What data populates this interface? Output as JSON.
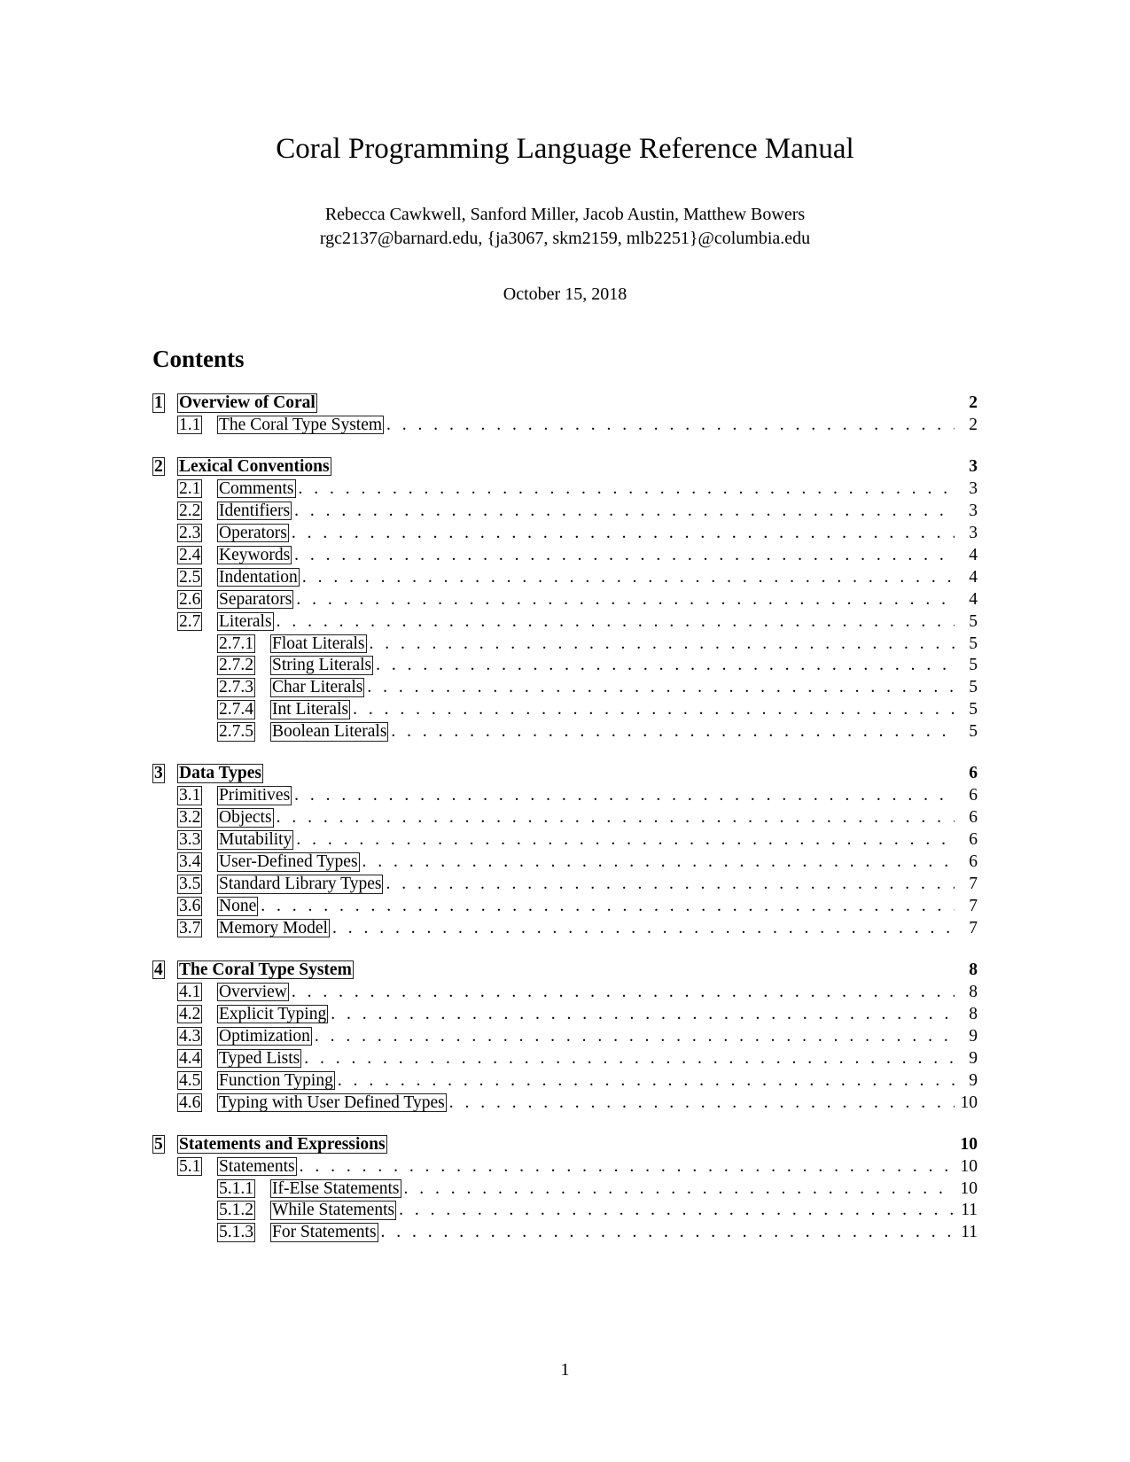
{
  "title": "Coral Programming Language Reference Manual",
  "authors_line1": "Rebecca Cawkwell, Sanford Miller, Jacob Austin, Matthew Bowers",
  "authors_line2": "rgc2137@barnard.edu, {ja3067, skm2159, mlb2251}@columbia.edu",
  "date": "October 15, 2018",
  "contents_heading": "Contents",
  "dots": ". . . . . . . . . . . . . . . . . . . . . . . . . . . . . . . . . . . . . . . . . . . . . . . . . . . . . . . . . . . . . . . . . . . . . . . . . . . . . . . . . . . . . . . . . . . . . . . . . . . . . . . . . . . . . . . . . . . . . . . . . . . . . . . . . . . . . . . . . . . . . . . .",
  "toc": [
    {
      "num": "1",
      "label": "Overview of Coral",
      "page": "2",
      "children": [
        {
          "num": "1.1",
          "label": "The Coral Type System",
          "page": "2"
        }
      ]
    },
    {
      "num": "2",
      "label": "Lexical Conventions",
      "page": "3",
      "children": [
        {
          "num": "2.1",
          "label": "Comments",
          "page": "3"
        },
        {
          "num": "2.2",
          "label": "Identifiers",
          "page": "3"
        },
        {
          "num": "2.3",
          "label": "Operators",
          "page": "3"
        },
        {
          "num": "2.4",
          "label": "Keywords",
          "page": "4"
        },
        {
          "num": "2.5",
          "label": "Indentation",
          "page": "4"
        },
        {
          "num": "2.6",
          "label": "Separators",
          "page": "4"
        },
        {
          "num": "2.7",
          "label": "Literals",
          "page": "5",
          "children": [
            {
              "num": "2.7.1",
              "label": "Float Literals",
              "page": "5"
            },
            {
              "num": "2.7.2",
              "label": "String Literals",
              "page": "5"
            },
            {
              "num": "2.7.3",
              "label": "Char Literals",
              "page": "5"
            },
            {
              "num": "2.7.4",
              "label": "Int Literals",
              "page": "5"
            },
            {
              "num": "2.7.5",
              "label": "Boolean Literals",
              "page": "5"
            }
          ]
        }
      ]
    },
    {
      "num": "3",
      "label": "Data Types",
      "page": "6",
      "children": [
        {
          "num": "3.1",
          "label": "Primitives",
          "page": "6"
        },
        {
          "num": "3.2",
          "label": "Objects",
          "page": "6"
        },
        {
          "num": "3.3",
          "label": "Mutability",
          "page": "6"
        },
        {
          "num": "3.4",
          "label": "User-Defined Types",
          "page": "6"
        },
        {
          "num": "3.5",
          "label": "Standard Library Types",
          "page": "7"
        },
        {
          "num": "3.6",
          "label": "None",
          "page": "7"
        },
        {
          "num": "3.7",
          "label": "Memory Model",
          "page": "7"
        }
      ]
    },
    {
      "num": "4",
      "label": "The Coral Type System",
      "page": "8",
      "children": [
        {
          "num": "4.1",
          "label": "Overview",
          "page": "8"
        },
        {
          "num": "4.2",
          "label": "Explicit Typing",
          "page": "8"
        },
        {
          "num": "4.3",
          "label": "Optimization",
          "page": "9"
        },
        {
          "num": "4.4",
          "label": "Typed Lists",
          "page": "9"
        },
        {
          "num": "4.5",
          "label": "Function Typing",
          "page": "9"
        },
        {
          "num": "4.6",
          "label": "Typing with User Defined Types",
          "page": "10"
        }
      ]
    },
    {
      "num": "5",
      "label": "Statements and Expressions",
      "page": "10",
      "children": [
        {
          "num": "5.1",
          "label": "Statements",
          "page": "10",
          "children": [
            {
              "num": "5.1.1",
              "label": "If-Else Statements",
              "page": "10"
            },
            {
              "num": "5.1.2",
              "label": "While Statements",
              "page": "11"
            },
            {
              "num": "5.1.3",
              "label": "For Statements",
              "page": "11"
            }
          ]
        }
      ]
    }
  ],
  "page_number": "1"
}
